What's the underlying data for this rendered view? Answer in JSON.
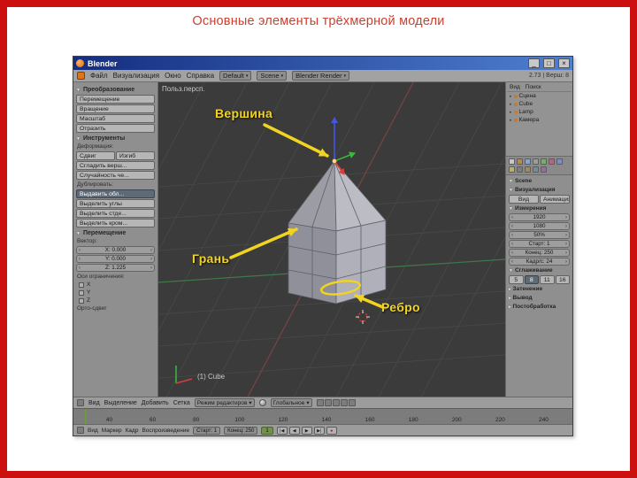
{
  "icons": {
    "chev_down": "▼",
    "chev_right": "▸",
    "tri_left": "‹",
    "tri_right": "›",
    "car": "▾"
  },
  "slide": {
    "title": "Основные элементы трёхмерной модели",
    "accent_color": "#c94030"
  },
  "window": {
    "title": "Blender",
    "buttons": {
      "min": "_",
      "max": "□",
      "close": "×"
    },
    "menus": [
      "Файл",
      "Визуализация",
      "Окно",
      "Справка"
    ],
    "layout": "Default",
    "scene": "Scene",
    "engine": "Blender Render",
    "version": "2.73 | Верш: 8"
  },
  "toolshelf": {
    "s1": {
      "header": "Преобразование",
      "buttons": [
        "Перемещение",
        "Вращение",
        "Масштаб",
        "Отразить"
      ]
    },
    "s2": {
      "header": "Инструменты",
      "label": "Деформация:",
      "pair": [
        "Сдвиг",
        "Изгиб"
      ],
      "buttons": [
        "Сгладить верш...",
        "Случайность че..."
      ]
    },
    "s3": {
      "label": "Дублировать:",
      "buttons": [
        "Выдавить обл...",
        "Выделить углы",
        "Выделить стде...",
        "Выделить кром..."
      ]
    },
    "s4": {
      "header": "Перемещение",
      "vector_label": "Вектор:",
      "fields": [
        "X: 0.000",
        "Y: 0.000",
        "Z: 1.225"
      ],
      "axes_label": "Оси ограничения:",
      "axes": [
        "X",
        "Y",
        "Z"
      ],
      "ortho_label": "Орто-сдвиг"
    }
  },
  "viewport": {
    "persp": "Польз.персп.",
    "object": "(1) Cube",
    "vertex_label": "Вершина",
    "face_label": "Грань",
    "edge_label": "Ребро",
    "annotation_color": "#f1d322"
  },
  "outliner": {
    "menus": [
      "Вид",
      "Поиск"
    ],
    "items": [
      "Сцена",
      "Cube",
      "Lamp",
      "Камера"
    ]
  },
  "props": {
    "scene_header": "Scene",
    "render_header": "Визуализация",
    "render_buttons": [
      "Вид",
      "Анимация"
    ],
    "dim_header": "Измерения",
    "sliders": [
      "1920",
      "1080",
      "50%",
      "Старт: 1",
      "Конец: 250",
      "Кадр/с: 24"
    ],
    "aa_header": "Сглаживание",
    "aa_buttons": [
      "5",
      "8",
      "11",
      "16"
    ],
    "shading_header": "Затенение",
    "output_header": "Вывод",
    "post_header": "Постобработка"
  },
  "view3d_header": {
    "menus": [
      "Вид",
      "Выделение",
      "Добавить",
      "Сетка"
    ],
    "mode": "Режим редактиров",
    "pivot": "Глобальное"
  },
  "timeline": {
    "ticks": [
      "40",
      "60",
      "80",
      "100",
      "120",
      "140",
      "160",
      "180",
      "200",
      "220",
      "240"
    ],
    "menus": [
      "Вид",
      "Маркер",
      "Кадр",
      "Воспроизведение"
    ],
    "start": "Старт: 1",
    "end": "Конец: 250",
    "frame": "1",
    "transport": [
      "|◀",
      "◀",
      "▶",
      "▶|"
    ],
    "record": "●"
  }
}
